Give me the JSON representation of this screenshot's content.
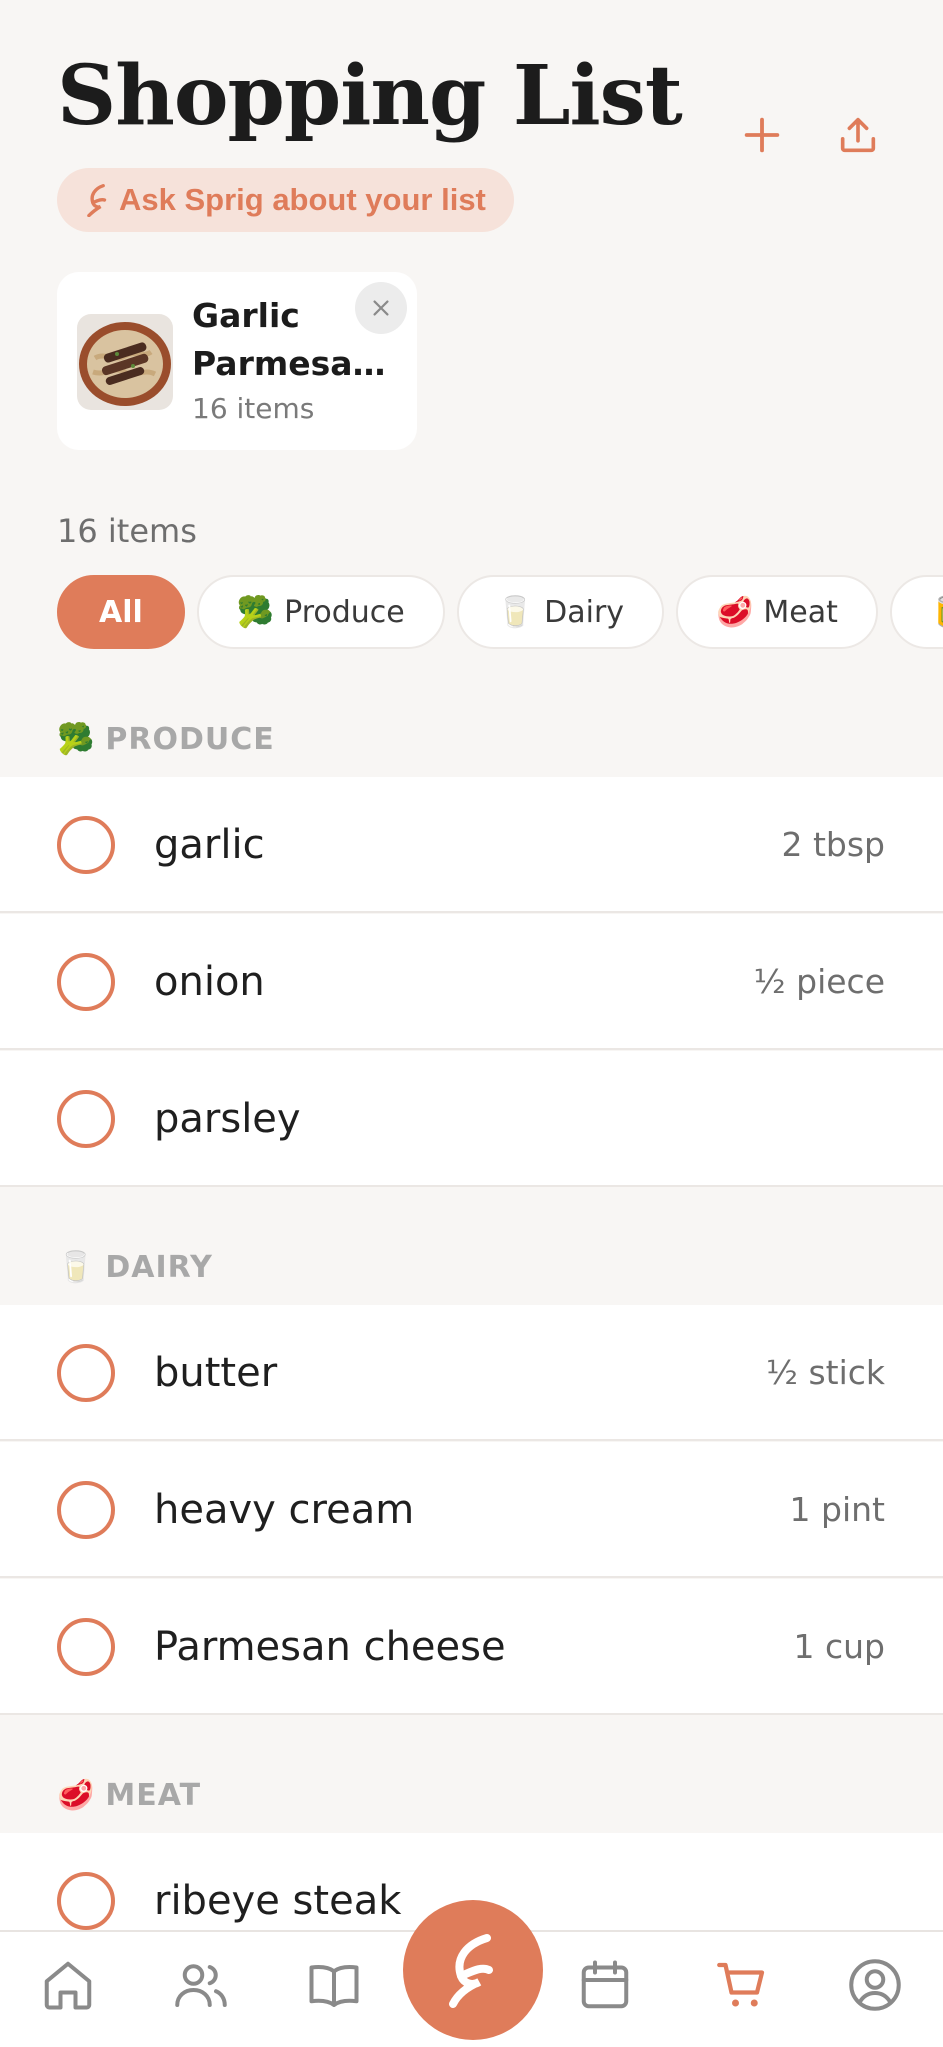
{
  "header": {
    "title": "Shopping List",
    "add_icon": "plus-icon",
    "share_icon": "upload-share-icon",
    "ask_label": "Ask Sprig about your list"
  },
  "recipe_card": {
    "name_line1": "Garlic",
    "name_line2": "Parmesan...",
    "items": "16 items",
    "close_icon": "close-icon"
  },
  "summary": {
    "count": "16 items"
  },
  "filters": [
    {
      "label": "All",
      "emoji": "",
      "active": true
    },
    {
      "label": "Produce",
      "emoji": "🥦",
      "active": false
    },
    {
      "label": "Dairy",
      "emoji": "🥛",
      "active": false
    },
    {
      "label": "Meat",
      "emoji": "🥩",
      "active": false
    },
    {
      "label": "",
      "emoji": "🥫",
      "active": false
    }
  ],
  "sections": [
    {
      "title": "PRODUCE",
      "emoji": "🥦",
      "items": [
        {
          "name": "garlic",
          "qty": "2 tbsp"
        },
        {
          "name": "onion",
          "qty": "½ piece"
        },
        {
          "name": "parsley",
          "qty": ""
        }
      ]
    },
    {
      "title": "DAIRY",
      "emoji": "🥛",
      "items": [
        {
          "name": "butter",
          "qty": "½ stick"
        },
        {
          "name": "heavy cream",
          "qty": "1 pint"
        },
        {
          "name": "Parmesan cheese",
          "qty": "1 cup"
        }
      ]
    },
    {
      "title": "MEAT",
      "emoji": "🥩",
      "items": [
        {
          "name": "ribeye steak",
          "qty": ""
        }
      ]
    }
  ],
  "bottom_nav": [
    {
      "icon": "home-icon",
      "active": false
    },
    {
      "icon": "people-icon",
      "active": false
    },
    {
      "icon": "book-icon",
      "active": false
    },
    {
      "icon": "sprig-leaf-icon",
      "active": false
    },
    {
      "icon": "calendar-icon",
      "active": false
    },
    {
      "icon": "cart-icon",
      "active": true
    },
    {
      "icon": "profile-icon",
      "active": false
    }
  ],
  "colors": {
    "accent": "#df7c5a",
    "background": "#f8f6f4",
    "pill_bg": "#f6e2da",
    "muted_text": "#6e6e6e",
    "section_text": "#a8a8a8",
    "nav_icon": "#8a8a8a"
  }
}
